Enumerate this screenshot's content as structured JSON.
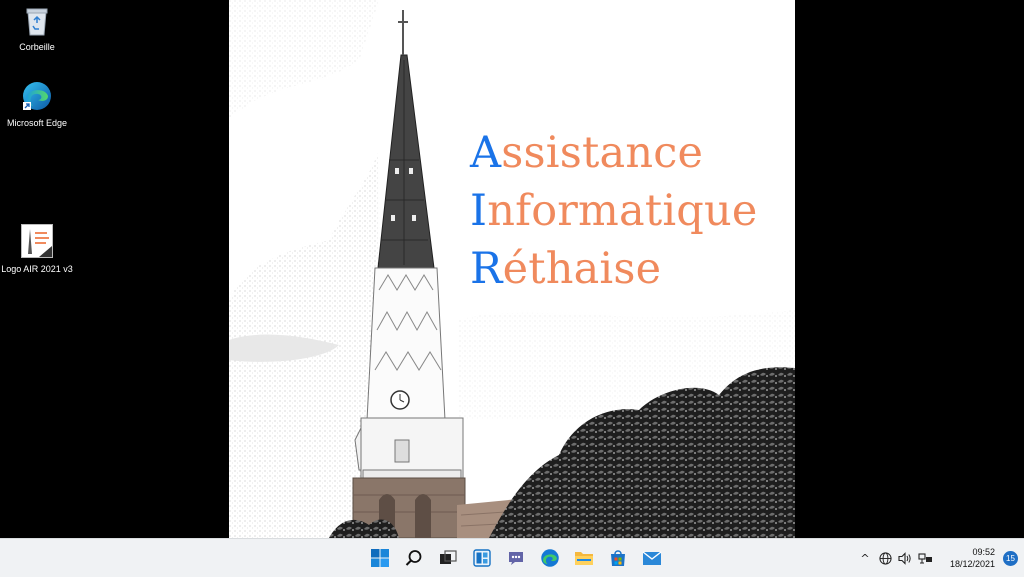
{
  "desktop": {
    "icons": [
      {
        "label": "Corbeille",
        "icon": "recycle-bin-icon"
      },
      {
        "label": "Microsoft Edge",
        "icon": "edge-icon"
      },
      {
        "label": "Logo AIR 2021 v3",
        "icon": "image-file-icon"
      }
    ]
  },
  "wallpaper": {
    "lines": [
      {
        "initial": "A",
        "rest": "ssistance"
      },
      {
        "initial": "I",
        "rest": "nformatique"
      },
      {
        "initial": "R",
        "rest": "éthaise"
      }
    ],
    "colors": {
      "initial": "#1a73e8",
      "rest": "#f08a5d"
    }
  },
  "taskbar": {
    "apps": [
      {
        "icon": "windows-start-icon"
      },
      {
        "icon": "search-icon"
      },
      {
        "icon": "task-view-icon"
      },
      {
        "icon": "widgets-icon"
      },
      {
        "icon": "teams-chat-icon"
      },
      {
        "icon": "edge-icon"
      },
      {
        "icon": "file-explorer-icon"
      },
      {
        "icon": "microsoft-store-icon"
      },
      {
        "icon": "mail-icon"
      }
    ],
    "tray": {
      "chevron": "^",
      "time": "09:52",
      "date": "18/12/2021",
      "notification_count": "15"
    }
  }
}
